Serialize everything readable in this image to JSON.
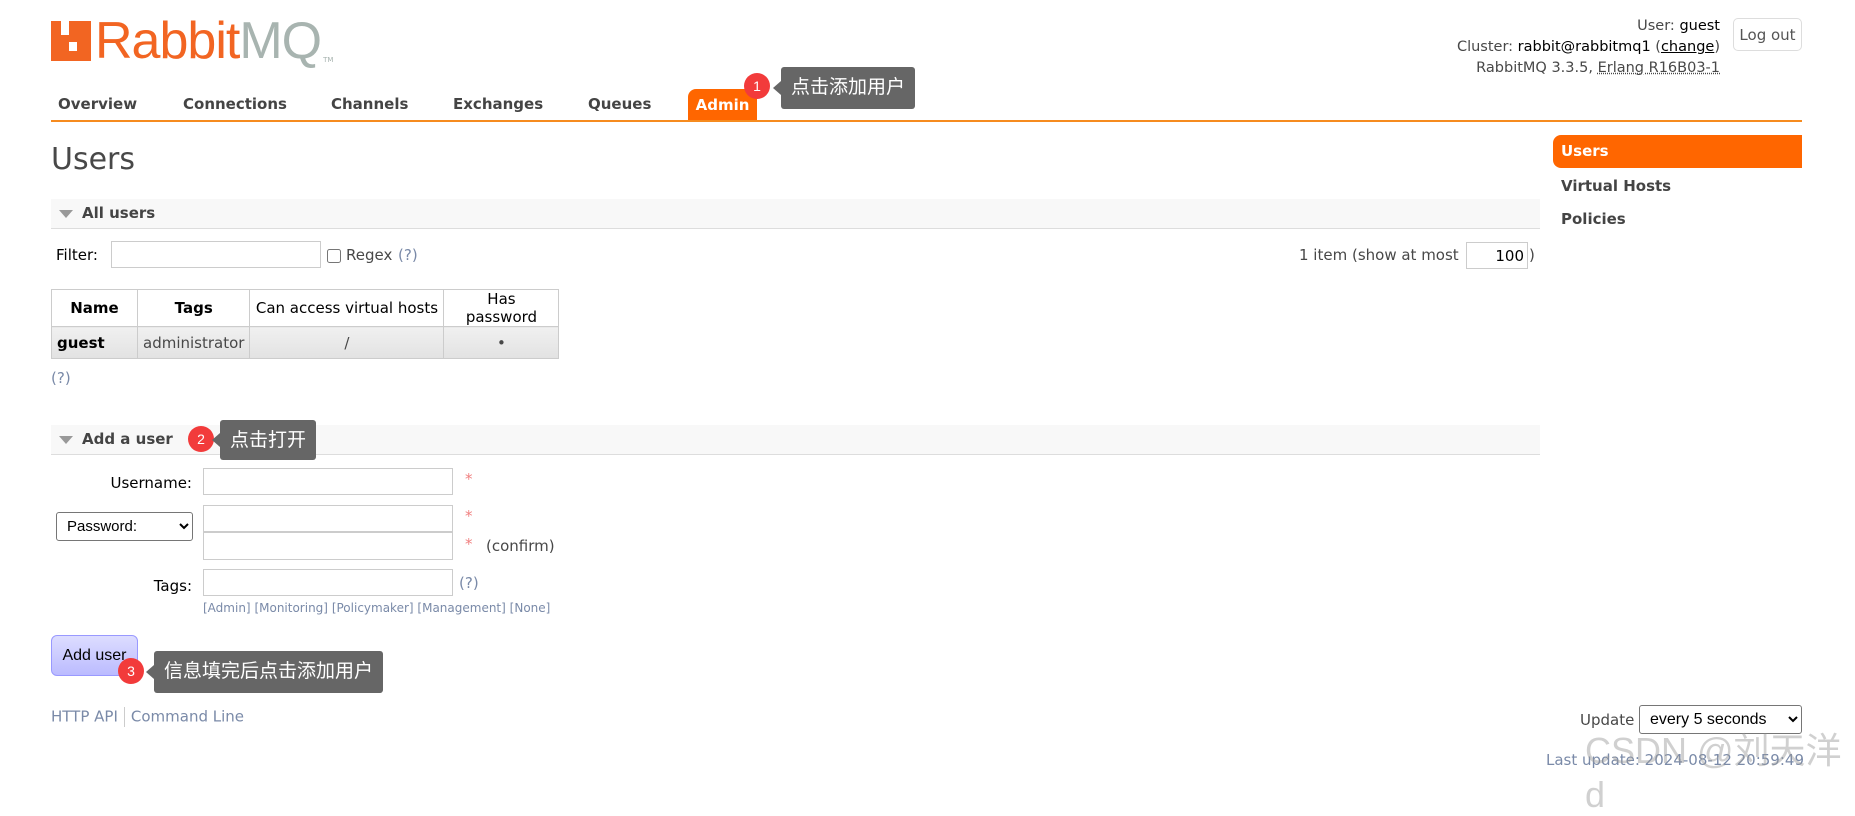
{
  "logo": {
    "brand_primary": "Rabbit",
    "brand_secondary": "MQ",
    "tm": "TM"
  },
  "tabs": [
    {
      "label": "Overview"
    },
    {
      "label": "Connections"
    },
    {
      "label": "Channels"
    },
    {
      "label": "Exchanges"
    },
    {
      "label": "Queues"
    },
    {
      "label": "Admin",
      "active": true
    }
  ],
  "header_info": {
    "user_label": "User:",
    "user": "guest",
    "cluster_label": "Cluster:",
    "cluster": "rabbit@rabbitmq1",
    "change": "change",
    "version": "RabbitMQ 3.3.5,",
    "erlang": "Erlang R16B03-1",
    "logout": "Log out"
  },
  "page_title": "Users",
  "sidebar": {
    "items": [
      {
        "label": "Users",
        "active": true
      },
      {
        "label": "Virtual Hosts"
      },
      {
        "label": "Policies"
      }
    ]
  },
  "all_users": {
    "title": "All users",
    "filter_label": "Filter:",
    "filter_value": "",
    "regex_label": "Regex",
    "help": "(?)",
    "count_text": "1 item (show at most",
    "max_value": "100",
    "close_paren": ")",
    "columns": [
      "Name",
      "Tags",
      "Can access virtual hosts",
      "Has password"
    ],
    "rows": [
      {
        "name": "guest",
        "tags": "administrator",
        "vhosts": "/",
        "has_password": "•"
      }
    ],
    "footer_help": "(?)"
  },
  "add_user": {
    "title": "Add a user",
    "username_label": "Username:",
    "password_select": "Password:",
    "required": "*",
    "confirm": "(confirm)",
    "tags_label": "Tags:",
    "tags_help": "(?)",
    "tag_shortcuts": [
      "[Admin]",
      "[Monitoring]",
      "[Policymaker]",
      "[Management]",
      "[None]"
    ],
    "submit": "Add user"
  },
  "annotations": [
    {
      "num": "1",
      "text": "点击添加用户"
    },
    {
      "num": "2",
      "text": "点击打开"
    },
    {
      "num": "3",
      "text": "信息填完后点击添加用户"
    }
  ],
  "footer": {
    "links": [
      "HTTP API",
      "Command Line"
    ],
    "update_label": "Update",
    "update_value": "every 5 seconds",
    "last_update": "Last update: 2024-08-12 20:59:49"
  },
  "watermark": "CSDN @刘天洋d",
  "colors": {
    "accent": "#ff6600",
    "rule": "#f68b1f",
    "badge": "#f23b3b",
    "tooltip": "#666666"
  }
}
